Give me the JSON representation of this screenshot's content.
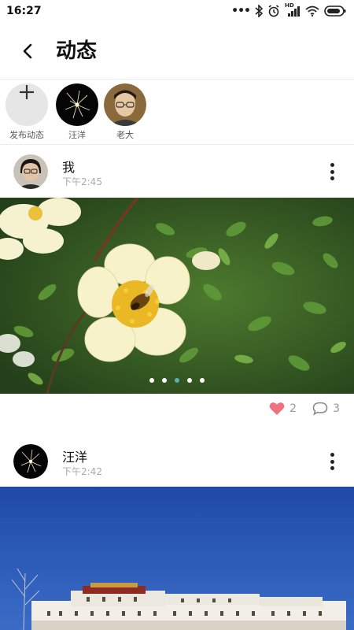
{
  "status_bar": {
    "time": "16:27",
    "icons": [
      "more-dots-icon",
      "bluetooth-icon",
      "alarm-icon",
      "hd-signal-icon",
      "wifi-icon",
      "battery-icon"
    ],
    "hd_label": "HD"
  },
  "header": {
    "back_icon": "chevron-left-icon",
    "title": "动态"
  },
  "stories": [
    {
      "label": "发布动态",
      "type": "add",
      "icon": "plus-icon"
    },
    {
      "label": "汪洋",
      "type": "avatar"
    },
    {
      "label": "老大",
      "type": "avatar"
    }
  ],
  "posts": [
    {
      "author": "我",
      "time": "下午2:45",
      "pager": {
        "count": 5,
        "active_index": 2
      },
      "likes": "2",
      "comments": "3"
    },
    {
      "author": "汪洋",
      "time": "下午2:42"
    }
  ],
  "colors": {
    "like_heart": "#f0707f",
    "pager_active": "#5ab0b5",
    "sky": "#2b56b0"
  }
}
